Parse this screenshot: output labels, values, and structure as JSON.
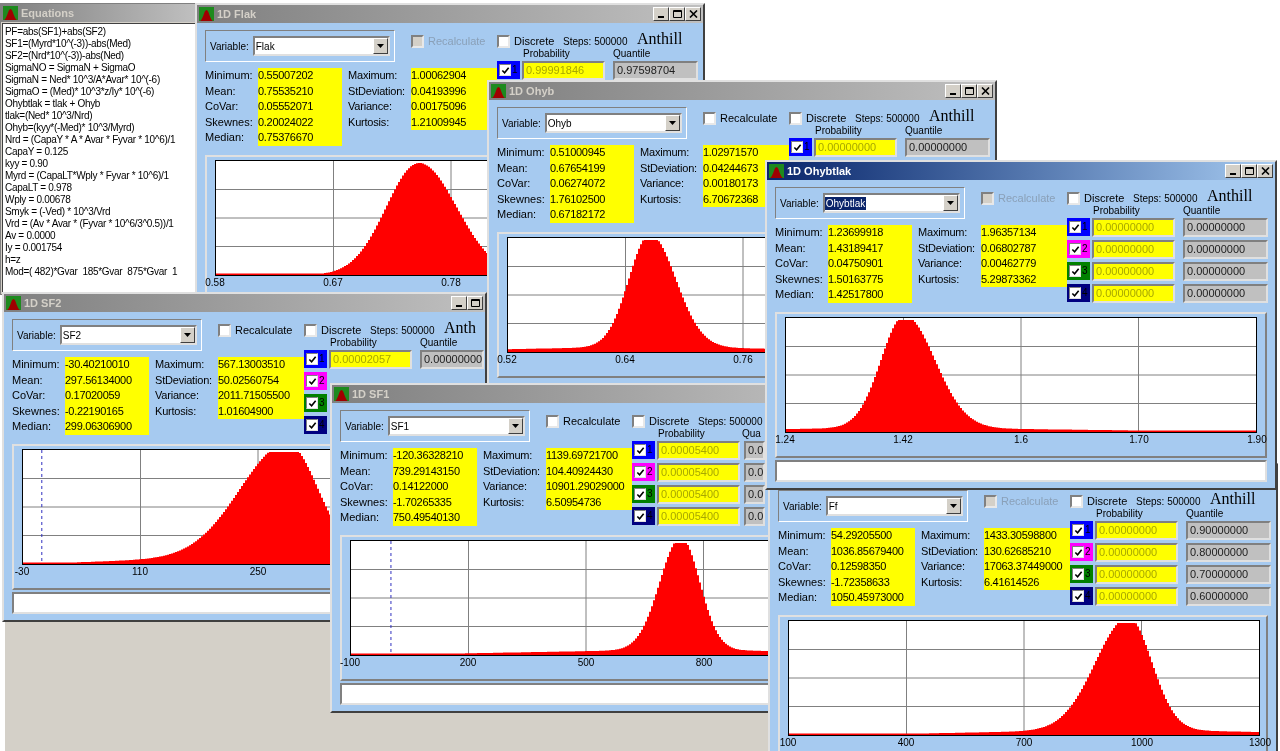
{
  "equations": {
    "title": "Equations",
    "active": false,
    "lines": [
      "PF=abs(SF1)+abs(SF2)",
      "SF1=(Myrd*10^(-3))-abs(Med)",
      "SF2=(Nrd*10^(-3))-abs(Ned)",
      "SigmaNO = SigmaN + SigmaO",
      "SigmaN = Ned* 10^3/A*Avar* 10^(-6)",
      "SigmaO = (Med)* 10^3*z/Iy* 10^(-6)",
      "Ohybtlak = tlak + Ohyb",
      "tlak=(Ned* 10^3/Nrd)",
      "Ohyb=(kyy*(-Med)* 10^3/Myrd)",
      "Nrd = (CapaY * A * Avar * Fyvar * 10^6)/1",
      "CapaY = 0.125",
      "kyy = 0.90",
      "Myrd = (CapaLT*Wply * Fyvar * 10^6)/1",
      "CapaLT = 0.978",
      "Wply = 0.00678",
      "Smyk = (-Ved) * 10^3/Vrd",
      "Vrd = (Av * Avar * (Fyvar * 10^6/3^0.5))/1",
      "Av = 0.0000",
      "Iy = 0.001754",
      "h=z",
      "Mod=( 482)*Gvar  185*Gvar  875*Gvar  1"
    ]
  },
  "windows": [
    {
      "title": "1D Flak",
      "active": false,
      "buttons": {
        "minimize": true,
        "maximize": true,
        "close": true
      },
      "variable_label": "Variable:",
      "variable": {
        "value": "Flak",
        "selected": false
      },
      "recalculate": {
        "label": "Recalculate",
        "disabled": true
      },
      "discrete": {
        "label": "Discrete",
        "checked": false
      },
      "steps": "Steps: 500000",
      "brand": "Anthill",
      "probability_header": "Probability",
      "quantile_header": "Quantile",
      "rows": [
        {
          "index": "1",
          "checked": true,
          "color": "#0000ff",
          "probability": "0.99991846",
          "quantile": "0.97598704"
        }
      ],
      "stats_left": [
        {
          "label": "Minimum:",
          "value": "0.55007202"
        },
        {
          "label": "Mean:",
          "value": "0.75535210"
        },
        {
          "label": "CoVar:",
          "value": "0.05552071"
        },
        {
          "label": "Skewnes:",
          "value": "0.20024022"
        },
        {
          "label": "Median:",
          "value": "0.75376670"
        }
      ],
      "stats_right": [
        {
          "label": "Maximum:",
          "value": "1.00062904"
        },
        {
          "label": "StDeviation:",
          "value": "0.04193996"
        },
        {
          "label": "Variance:",
          "value": "0.00175096"
        },
        {
          "label": "Kurtosis:",
          "value": "1.21009945"
        }
      ],
      "ticks": [
        "0.58",
        "0.67",
        "0.78"
      ]
    },
    {
      "title": "1D Ohyb",
      "active": false,
      "buttons": {
        "minimize": true,
        "maximize": true,
        "close": true
      },
      "variable_label": "Variable:",
      "variable": {
        "value": "Ohyb",
        "selected": false
      },
      "recalculate": {
        "label": "Recalculate",
        "disabled": false
      },
      "discrete": {
        "label": "Discrete",
        "checked": false
      },
      "steps": "Steps: 500000",
      "brand": "Anthill",
      "probability_header": "Probability",
      "quantile_header": "Quantile",
      "rows": [
        {
          "index": "1",
          "checked": true,
          "color": "#0000ff",
          "probability": "0.00000000",
          "quantile": "0.00000000"
        }
      ],
      "stats_left": [
        {
          "label": "Minimum:",
          "value": "0.51000945"
        },
        {
          "label": "Mean:",
          "value": "0.67654199"
        },
        {
          "label": "CoVar:",
          "value": "0.06274072"
        },
        {
          "label": "Skewnes:",
          "value": "1.76102500"
        },
        {
          "label": "Median:",
          "value": "0.67182172"
        }
      ],
      "stats_right": [
        {
          "label": "Maximum:",
          "value": "1.02971570"
        },
        {
          "label": "StDeviation:",
          "value": "0.04244673"
        },
        {
          "label": "Variance:",
          "value": "0.00180173"
        },
        {
          "label": "Kurtosis:",
          "value": "6.70672368"
        }
      ],
      "ticks": [
        "0.52",
        "0.64",
        "0.76"
      ]
    },
    {
      "title": "1D Ohybtlak",
      "active": true,
      "buttons": {
        "minimize": true,
        "maximize": true,
        "close": true
      },
      "variable_label": "Variable:",
      "variable": {
        "value": "Ohybtlak",
        "selected": true
      },
      "recalculate": {
        "label": "Recalculate",
        "disabled": true
      },
      "discrete": {
        "label": "Discrete",
        "checked": false
      },
      "steps": "Steps: 500000",
      "brand": "Anthill",
      "probability_header": "Probability",
      "quantile_header": "Quantile",
      "rows": [
        {
          "index": "1",
          "checked": true,
          "color": "#0000ff",
          "probability": "0.00000000",
          "quantile": "0.00000000"
        },
        {
          "index": "2",
          "checked": true,
          "color": "#ff00ff",
          "probability": "0.00000000",
          "quantile": "0.00000000"
        },
        {
          "index": "3",
          "checked": true,
          "color": "#008000",
          "probability": "0.00000000",
          "quantile": "0.00000000"
        },
        {
          "index": "4",
          "checked": true,
          "color": "#000080",
          "probability": "0.00000000",
          "quantile": "0.00000000"
        }
      ],
      "stats_left": [
        {
          "label": "Minimum:",
          "value": "1.23699918"
        },
        {
          "label": "Mean:",
          "value": "1.43189417"
        },
        {
          "label": "CoVar:",
          "value": "0.04750901"
        },
        {
          "label": "Skewnes:",
          "value": "1.50163775"
        },
        {
          "label": "Median:",
          "value": "1.42517800"
        }
      ],
      "stats_right": [
        {
          "label": "Maximum:",
          "value": "1.96357134"
        },
        {
          "label": "StDeviation:",
          "value": "0.06802787"
        },
        {
          "label": "Variance:",
          "value": "0.00462779"
        },
        {
          "label": "Kurtosis:",
          "value": "5.29873362"
        }
      ],
      "ticks": [
        "1.24",
        "1.42",
        "1.6",
        "1.70",
        "1.90"
      ]
    },
    {
      "title": "1D SF2",
      "active": false,
      "buttons": {
        "minimize": true,
        "maximize": true
      },
      "variable_label": "Variable:",
      "variable": {
        "value": "SF2",
        "selected": false
      },
      "recalculate": {
        "label": "Recalculate",
        "disabled": false
      },
      "discrete": {
        "label": "Discrete",
        "checked": false
      },
      "steps": "Steps: 500000",
      "brand": "Anth",
      "probability_header": "Probability",
      "quantile_header": "Quantile",
      "rows": [
        {
          "index": "1",
          "checked": true,
          "color": "#0000ff",
          "probability": "0.00002057",
          "quantile": "0.00000000"
        },
        {
          "index": "2",
          "checked": true,
          "color": "#ff00ff"
        },
        {
          "index": "3",
          "checked": true,
          "color": "#008000"
        },
        {
          "index": "4",
          "checked": true,
          "color": "#000080"
        }
      ],
      "stats_left": [
        {
          "label": "Minimum:",
          "value": "-30.40210010"
        },
        {
          "label": "Mean:",
          "value": "297.56134000"
        },
        {
          "label": "CoVar:",
          "value": "0.17020059"
        },
        {
          "label": "Skewnes:",
          "value": "-0.22190165"
        },
        {
          "label": "Median:",
          "value": "299.06306900"
        }
      ],
      "stats_right": [
        {
          "label": "Maximum:",
          "value": "567.13003510"
        },
        {
          "label": "StDeviation:",
          "value": "50.02560754"
        },
        {
          "label": "Variance:",
          "value": "2011.71505500"
        },
        {
          "label": "Kurtosis:",
          "value": "1.01604900"
        }
      ],
      "ticks": [
        "-30",
        "110",
        "250"
      ]
    },
    {
      "title": "1D SF1",
      "active": false,
      "variable_label": "Variable:",
      "variable": {
        "value": "SF1",
        "selected": false
      },
      "recalculate": {
        "label": "Recalculate",
        "disabled": false
      },
      "discrete": {
        "label": "Discrete",
        "checked": false
      },
      "steps": "Steps: 500000",
      "probability_header": "Probability",
      "quantile_header": "Qua",
      "rows": [
        {
          "index": "1",
          "checked": true,
          "color": "#0000ff",
          "probability": "0.00005400",
          "quantile": "0.0"
        },
        {
          "index": "2",
          "checked": true,
          "color": "#ff00ff",
          "probability": "0.00005400",
          "quantile": "0.0"
        },
        {
          "index": "3",
          "checked": true,
          "color": "#008000",
          "probability": "0.00005400",
          "quantile": "0.0"
        },
        {
          "index": "4",
          "checked": true,
          "color": "#000080",
          "probability": "0.00005400",
          "quantile": "0.0"
        }
      ],
      "stats_left": [
        {
          "label": "Minimum:",
          "value": "-120.36328210"
        },
        {
          "label": "Mean:",
          "value": "739.29143150"
        },
        {
          "label": "CoVar:",
          "value": "0.14122000"
        },
        {
          "label": "Skewnes:",
          "value": "-1.70265335"
        },
        {
          "label": "Median:",
          "value": "750.49540130"
        }
      ],
      "stats_right": [
        {
          "label": "Maximum:",
          "value": "1139.69721700"
        },
        {
          "label": "StDeviation:",
          "value": "104.40924430"
        },
        {
          "label": "Variance:",
          "value": "10901.29029000"
        },
        {
          "label": "Kurtosis:",
          "value": "6.50954736"
        }
      ],
      "ticks": [
        "-100",
        "200",
        "500",
        "800"
      ]
    },
    {
      "variable_label": "Variable:",
      "variable": {
        "value": "Ff",
        "selected": false
      },
      "recalculate": {
        "label": "Recalculate",
        "disabled": true
      },
      "discrete": {
        "label": "Discrete",
        "checked": false
      },
      "steps": "Steps: 500000",
      "brand": "Anthill",
      "probability_header": "Probability",
      "quantile_header": "Quantile",
      "rows": [
        {
          "index": "1",
          "checked": true,
          "color": "#0000ff",
          "probability": "0.00000000",
          "quantile": "0.90000000"
        },
        {
          "index": "2",
          "checked": true,
          "color": "#ff00ff",
          "probability": "0.00000000",
          "quantile": "0.80000000"
        },
        {
          "index": "3",
          "checked": true,
          "color": "#008000",
          "probability": "0.00000000",
          "quantile": "0.70000000"
        },
        {
          "index": "4",
          "checked": true,
          "color": "#000080",
          "probability": "0.00000000",
          "quantile": "0.60000000"
        }
      ],
      "stats_left": [
        {
          "label": "Minimum:",
          "value": "54.29205500"
        },
        {
          "label": "Mean:",
          "value": "1036.85679400"
        },
        {
          "label": "CoVar:",
          "value": "0.12598350"
        },
        {
          "label": "Skewnes:",
          "value": "-1.72358633"
        },
        {
          "label": "Median:",
          "value": "1050.45973000"
        }
      ],
      "stats_right": [
        {
          "label": "Maximum:",
          "value": "1433.30598800"
        },
        {
          "label": "StDeviation:",
          "value": "130.62685210"
        },
        {
          "label": "Variance:",
          "value": "17063.37449000"
        },
        {
          "label": "Kurtosis:",
          "value": "6.41614526"
        }
      ],
      "ticks": [
        "100",
        "400",
        "700",
        "1000",
        "1300"
      ]
    }
  ]
}
